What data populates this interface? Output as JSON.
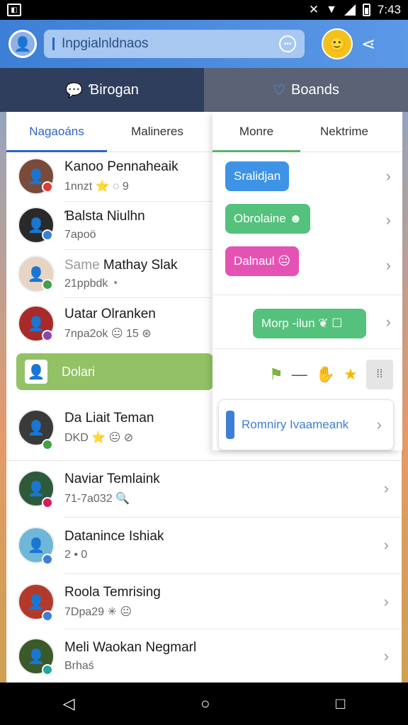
{
  "status": {
    "time": "7:43"
  },
  "search": {
    "text": "Inpgialnldnaos"
  },
  "top_tabs": [
    {
      "label": "Ɓirogan",
      "icon": "chat-bubble-icon"
    },
    {
      "label": "Boands",
      "icon": "heart-icon"
    }
  ],
  "left_tabs": [
    "Nagaoáns",
    "Malineres"
  ],
  "right_tabs": [
    "Monre",
    "Nektrime"
  ],
  "contacts": [
    {
      "name": "Kanoo Pennaheaik",
      "sub": "1nnzt ⭐ ◌ 9",
      "badge": "#e53935"
    },
    {
      "name": "Ɓalsta Niulhn",
      "sub": "7apoö",
      "badge": "#3d7fd6"
    },
    {
      "name_dim": "Same",
      "name": "Mathay Slak",
      "sub": "21ppbdk ◔",
      "badge": "#43a047"
    },
    {
      "name": "Uatar Olranken",
      "sub": "7npa2ok 😐 15 ⊛",
      "badge": "#8e44ad"
    },
    {
      "name": "Da Liait Teman",
      "sub": "DKD ⭐ 😐 ⊘",
      "badge": "#43a047"
    },
    {
      "name": "Naviar Temlaink",
      "sub": "71-7a032 🔍",
      "badge": "#d81b60"
    },
    {
      "name": "Datanince Ishiak",
      "sub": "2 • 0",
      "badge": "#3d7fd6"
    },
    {
      "name": "Roola Temrising",
      "sub": "7Dpa29 ✳ 😐",
      "badge": "#3d7fd6"
    },
    {
      "name": "Meli Waokan Negmarl",
      "sub": "Brhaś",
      "badge": "#26a69a"
    }
  ],
  "highlight": {
    "label": "Dolari"
  },
  "bubbles": [
    "Sralidjan",
    "Obrolaine ☻",
    "Dalnaul 😐",
    "Morp -ilun ❦ ☐"
  ],
  "pin_card": {
    "label": "Romniry Ivaameank"
  }
}
